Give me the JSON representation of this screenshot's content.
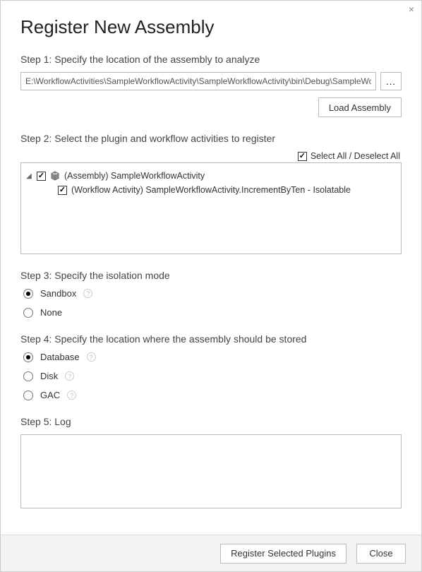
{
  "title": "Register New Assembly",
  "close_label": "×",
  "step1": {
    "label": "Step 1: Specify the location of the assembly to analyze",
    "path_value": "E:\\WorkflowActivities\\SampleWorkflowActivity\\SampleWorkflowActivity\\bin\\Debug\\SampleWo",
    "browse_label": "...",
    "load_label": "Load Assembly"
  },
  "step2": {
    "label": "Step 2: Select the plugin and workflow activities to register",
    "select_all_label": "Select All / Deselect All",
    "assembly_label": "(Assembly) SampleWorkflowActivity",
    "activity_label": "(Workflow Activity) SampleWorkflowActivity.IncrementByTen - Isolatable"
  },
  "step3": {
    "label": "Step 3: Specify the isolation mode",
    "sandbox_label": "Sandbox",
    "none_label": "None"
  },
  "step4": {
    "label": "Step 4: Specify the location where the assembly should be stored",
    "database_label": "Database",
    "disk_label": "Disk",
    "gac_label": "GAC"
  },
  "step5": {
    "label": "Step 5: Log"
  },
  "footer": {
    "register_label": "Register Selected Plugins",
    "close_label": "Close"
  },
  "help_tooltip": "?"
}
